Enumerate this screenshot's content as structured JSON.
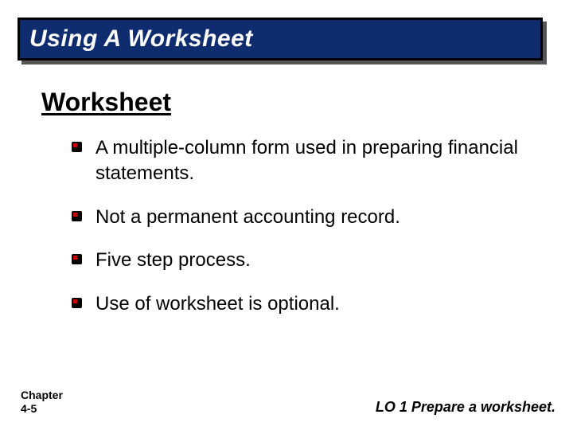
{
  "title": "Using A Worksheet",
  "section_heading": "Worksheet",
  "bullets": [
    "A multiple-column form used in preparing financial statements.",
    "Not a permanent accounting record.",
    "Five step process.",
    "Use of worksheet is optional."
  ],
  "footer": {
    "chapter_line1": "Chapter",
    "chapter_line2": "4-5",
    "lo": "LO 1  Prepare a worksheet."
  }
}
